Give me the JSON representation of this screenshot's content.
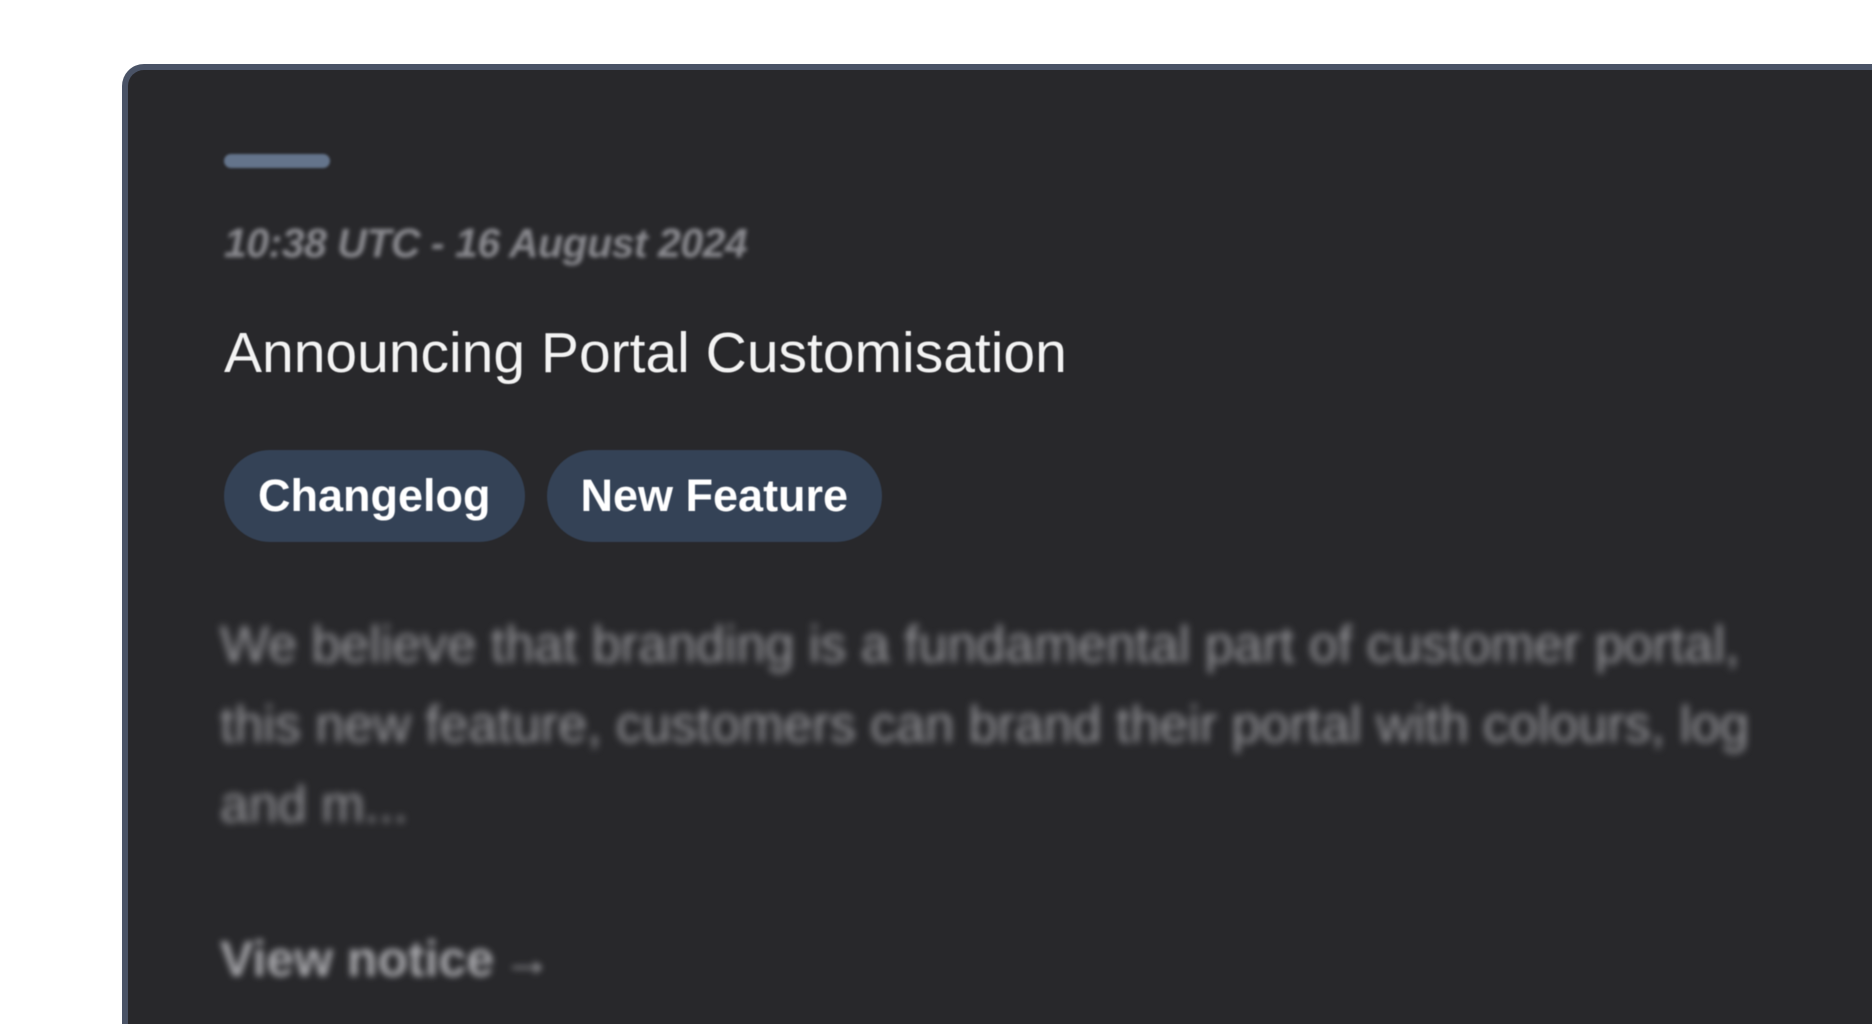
{
  "notice": {
    "timestamp": "10:38 UTC - 16 August 2024",
    "title": "Announcing Portal Customisation",
    "tags": [
      "Changelog",
      "New Feature"
    ],
    "body_lines": [
      "We believe that branding is a fundamental part of customer portal,",
      "this new feature, customers can brand their portal with colours, log",
      "and m..."
    ],
    "view_link_label": "View notice",
    "view_link_icon": "arrow-right-icon"
  },
  "colors": {
    "card_background": "#28282b",
    "card_border": "#4a5366",
    "accent_bar": "#64748b",
    "tag_background": "#344256"
  }
}
